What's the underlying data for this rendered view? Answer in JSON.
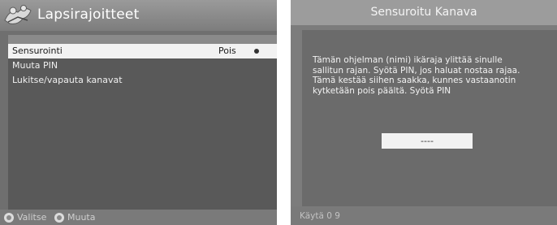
{
  "left_screen": {
    "title": "Lapsirajoitteet",
    "menu_items": [
      {
        "label": "Sensurointi",
        "value": "Pois"
      },
      {
        "label": "Muuta PIN"
      },
      {
        "label": "Lukitse/vapauta kanavat"
      }
    ],
    "footer": {
      "select_label": "Valitse",
      "change_label": "Muuta"
    }
  },
  "right_screen": {
    "title": "Sensuroitu Kanava",
    "message": "Tämän ohjelman (nimi) ikäraja ylittää sinulle\nsallitun rajan. Syötä PIN, jos haluat nostaa rajaa.\nTämä kestää siihen saakka, kunnes vastaanotin\nkytketään pois päältä. Syötä PIN",
    "pin_value": "----",
    "footer_text": "Käytä 0 9"
  }
}
